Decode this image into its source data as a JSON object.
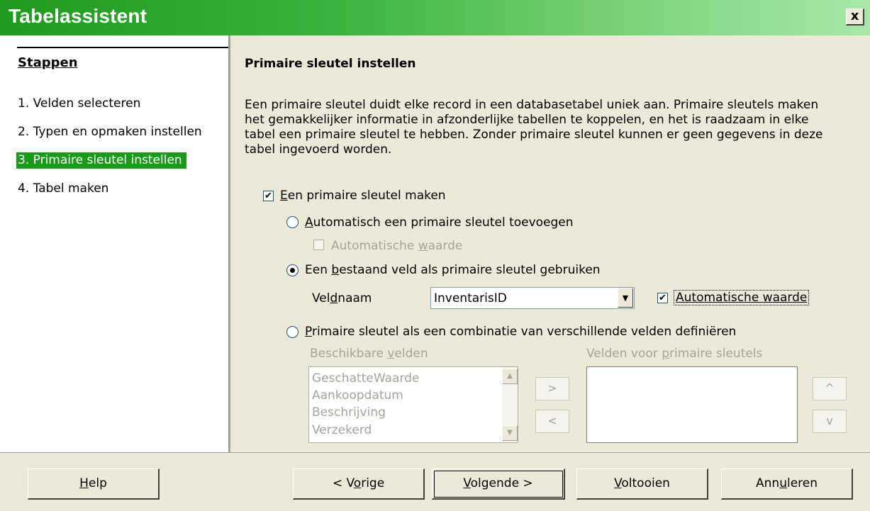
{
  "window": {
    "title": "Tabelassistent",
    "close_glyph": "x"
  },
  "sidebar": {
    "heading": "Stappen",
    "steps": [
      "1. Velden selecteren",
      "2. Typen en opmaken instellen",
      "3. Primaire sleutel instellen",
      "4. Tabel maken"
    ],
    "active_step": 3
  },
  "main": {
    "title": "Primaire sleutel instellen",
    "description": "Een primaire sleutel duidt elke record in een databasetabel uniek aan. Primaire sleutels maken het gemakkelijker informatie in afzonderlijke tabellen te koppelen, en het is raadzaam in elke tabel een primaire sleutel te hebben. Zonder primaire sleutel kunnen er geen gegevens in deze tabel ingevoerd worden.",
    "create_pk": {
      "label_key": "E",
      "label_rest": "en primaire sleutel maken",
      "checked": true
    },
    "option_auto": {
      "label_key": "A",
      "label_rest": "utomatisch een primaire sleutel toevoegen",
      "selected": false
    },
    "auto_value_1": {
      "label_pre": "Automatische ",
      "label_key": "w",
      "label_post": "aarde",
      "checked": false,
      "enabled": false
    },
    "option_existing": {
      "label_pre": "Een ",
      "label_key": "b",
      "label_post": "estaand veld als primaire sleutel gebruiken",
      "selected": true
    },
    "fieldname": {
      "label_pre": "Vel",
      "label_key": "d",
      "label_post": "naam",
      "value": "InventarisID",
      "arrow_glyph": "▼"
    },
    "auto_value_2": {
      "label": "Automatische waarde",
      "checked": true,
      "check_glyph": "✔"
    },
    "option_combo": {
      "label_key": "P",
      "label_rest": "rimaire sleutel als een combinatie van verschillende velden definiëren",
      "selected": false
    },
    "available_fields": {
      "label_pre": "Beschikbare ",
      "label_key": "v",
      "label_post": "elden",
      "items": [
        "GeschatteWaarde",
        "Aankoopdatum",
        "Beschrijving",
        "Verzekerd"
      ],
      "scroll_up": "▲",
      "scroll_down": "▼"
    },
    "pk_fields": {
      "label_pre": "Velden voor ",
      "label_key": "p",
      "label_post": "rimaire sleutels",
      "items": []
    },
    "move_right": ">",
    "move_left": "<",
    "move_up": "^",
    "move_down": "v"
  },
  "buttons": {
    "help": {
      "key": "H",
      "rest": "elp"
    },
    "back": {
      "pre": "< V",
      "key": "o",
      "post": "rige"
    },
    "next": {
      "key": "V",
      "rest": "olgende >"
    },
    "finish": {
      "key": "V",
      "rest": "oltooien"
    },
    "cancel": {
      "pre": "Ann",
      "key": "u",
      "post": "leren"
    }
  }
}
